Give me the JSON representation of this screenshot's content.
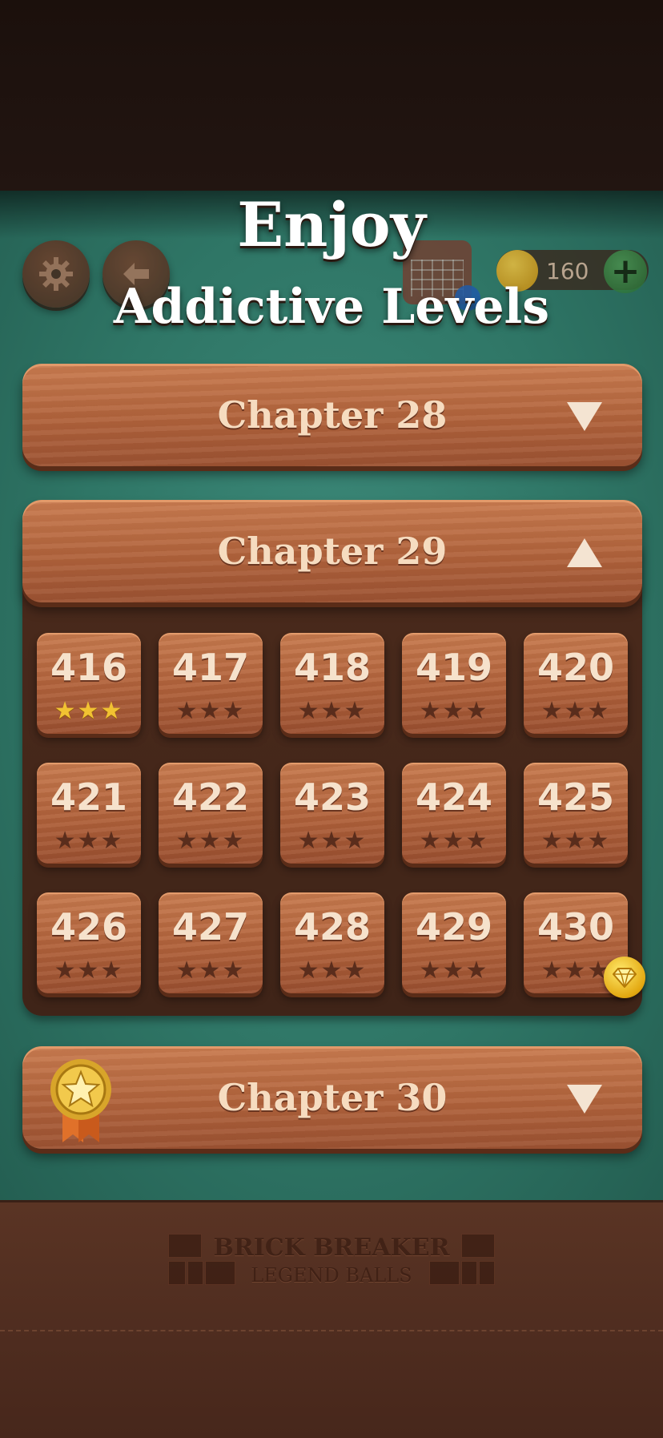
{
  "headline": {
    "line1": "Enjoy",
    "line2": "Addictive Levels"
  },
  "top_bar": {
    "settings_icon": "gear-icon",
    "back_icon": "arrow-left-icon",
    "calendar_icon": "calendar-icon",
    "currency_icon": "diamond-icon",
    "currency_value": "160",
    "add_icon": "plus-icon",
    "add_label": "+"
  },
  "chapters": [
    {
      "title": "Chapter 28",
      "state": "collapsed",
      "chevron": "▼"
    },
    {
      "title": "Chapter 29",
      "state": "expanded",
      "chevron": "▲"
    },
    {
      "title": "Chapter 30",
      "state": "collapsed",
      "chevron": "▼",
      "badge": "medal-icon"
    }
  ],
  "levels": [
    {
      "number": "416",
      "stars": 3
    },
    {
      "number": "417",
      "stars": 0
    },
    {
      "number": "418",
      "stars": 0
    },
    {
      "number": "419",
      "stars": 0
    },
    {
      "number": "420",
      "stars": 0
    },
    {
      "number": "421",
      "stars": 0
    },
    {
      "number": "422",
      "stars": 0
    },
    {
      "number": "423",
      "stars": 0
    },
    {
      "number": "424",
      "stars": 0
    },
    {
      "number": "425",
      "stars": 0
    },
    {
      "number": "426",
      "stars": 0
    },
    {
      "number": "427",
      "stars": 0
    },
    {
      "number": "428",
      "stars": 0
    },
    {
      "number": "429",
      "stars": 0
    },
    {
      "number": "430",
      "stars": 0,
      "reward": "diamond-icon"
    }
  ],
  "logo": {
    "line1": "BRICK BREAKER",
    "line2": "LEGEND BALLS"
  },
  "colors": {
    "felt": "#2f7666",
    "wood": "#b0623b",
    "star_earned": "#f1c232",
    "star_empty": "#5a2d1c",
    "text_light": "#f6dcc0"
  }
}
